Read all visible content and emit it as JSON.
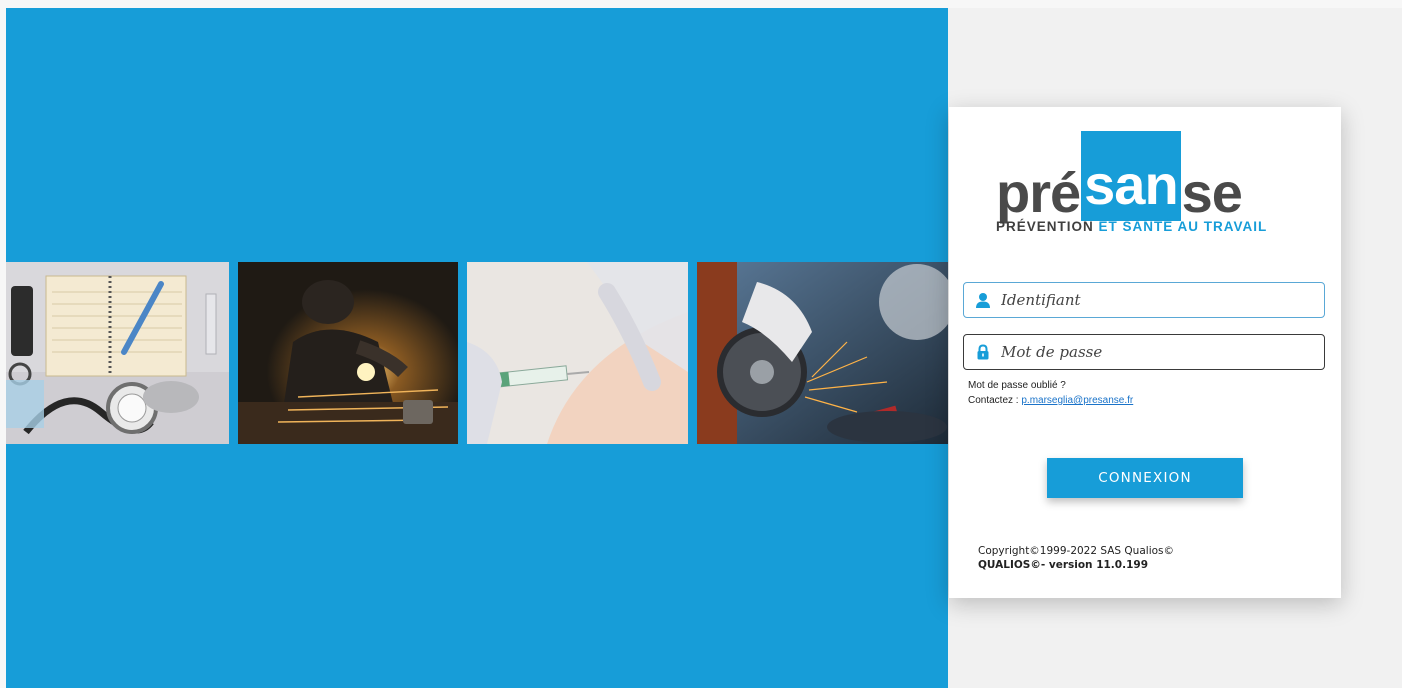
{
  "brand": {
    "logo_left": "pré",
    "logo_mid": "san",
    "logo_right": "se",
    "tagline_1": "PRÉVENTION",
    "tagline_2": "ET SANTÉ AU TRAVAIL",
    "accent_color": "#179dd8",
    "dark_color": "#4a4a4a"
  },
  "login": {
    "username_placeholder": "Identifiant",
    "password_placeholder": "Mot de passe",
    "username_icon": "user-icon",
    "password_icon": "lock-icon",
    "forgot_text": "Mot de passe oublié ?",
    "contact_label": "Contactez : ",
    "contact_email": "p.marseglia@presanse.fr",
    "submit_label": "CONNEXION"
  },
  "footer": {
    "copyright": "Copyright©1999-2022 SAS Qualios©",
    "version": "QUALIOS©- version 11.0.199"
  },
  "photos": [
    "medical-desk-photo",
    "welder-photo",
    "vaccination-photo",
    "grinder-photo"
  ]
}
